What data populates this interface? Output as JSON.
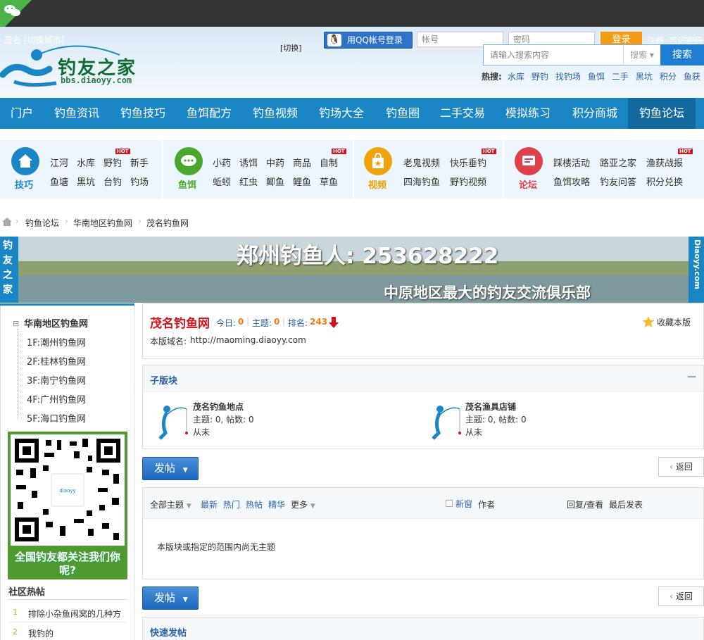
{
  "header": {
    "city": "茂名 [切换城市]",
    "switch": "[切换]",
    "logo_text": "钓友之家",
    "logo_url": "bbs.diaoyy.com",
    "qq_login": "用QQ帐号登录",
    "account_placeholder": "帐号",
    "password_placeholder": "密码",
    "login": "登录",
    "register": "注册",
    "forgot": "忘记密码",
    "search_placeholder": "请输入搜索内容",
    "search_select": "搜索",
    "search_button": "搜索",
    "hot_label": "热搜:",
    "hot_items": [
      "水库",
      "野钓",
      "找钓场",
      "鱼饵",
      "二手",
      "黑坑",
      "积分",
      "鱼获"
    ]
  },
  "nav": {
    "items": [
      "门户",
      "钓鱼资讯",
      "钓鱼技巧",
      "鱼饵配方",
      "钓鱼视频",
      "钓场大全",
      "钓鱼圈",
      "二手交易",
      "模拟练习",
      "积分商城",
      "钓鱼论坛"
    ],
    "active": "钓鱼论坛"
  },
  "quick": {
    "hot_badge": "HOT",
    "sections": [
      {
        "label": "技巧",
        "color": "#1b86c5",
        "icon": "house-icon",
        "row1": [
          "江河",
          "水库",
          "野钓",
          "新手"
        ],
        "row2": [
          "鱼塘",
          "黑坑",
          "台钓",
          "钓场"
        ]
      },
      {
        "label": "鱼饵",
        "color": "#4aa92c",
        "icon": "chat-bubble-icon",
        "row1": [
          "小药",
          "诱饵",
          "中药",
          "商品",
          "自制"
        ],
        "row2": [
          "蚯蚓",
          "红虫",
          "鲫鱼",
          "鲤鱼",
          "草鱼"
        ]
      },
      {
        "label": "视频",
        "color": "#f0a20b",
        "icon": "shopping-bag-icon",
        "row1": [
          "老鬼视频",
          "快乐垂钓"
        ],
        "row2": [
          "四海钓鱼",
          "野钓视频"
        ]
      },
      {
        "label": "论坛",
        "color": "#e0404a",
        "icon": "forum-icon",
        "row1": [
          "踩楼活动",
          "路亚之家",
          "渔获战报"
        ],
        "row2": [
          "鱼饵攻略",
          "钓友问答",
          "积分兑换"
        ]
      }
    ]
  },
  "breadcrumb": [
    "钓鱼论坛",
    "华南地区钓鱼网",
    "茂名钓鱼网"
  ],
  "banner": {
    "left_text": "钓友之家",
    "headline": "郑州钓鱼人: 253628222",
    "sub": "中原地区最大的钓友交流俱乐部",
    "right_text": "Diaoyy.com"
  },
  "sidebar": {
    "tree_root": "华南地区钓鱼网",
    "tree_items": [
      "1F:潮州钓鱼网",
      "2F:桂林钓鱼网",
      "3F:南宁钓鱼网",
      "4F:广州钓鱼网",
      "5F:海口钓鱼网"
    ],
    "qr_caption": "全国钓友都关注我们你呢?",
    "hot_title": "社区热帖",
    "hot_posts": [
      {
        "num": "1",
        "title": "排除小杂鱼闹窝的几种方"
      },
      {
        "num": "2",
        "title": "我钓的"
      }
    ]
  },
  "forum": {
    "name": "茂名钓鱼网",
    "today_label": "今日:",
    "today": "0",
    "topics_label": "主题:",
    "topics": "0",
    "rank_label": "排名:",
    "rank": "243",
    "domain_label": "本版域名:",
    "domain": "http://maoming.diaoyy.com",
    "favorite": "收藏本版"
  },
  "subforums": {
    "title": "子版块",
    "collapse": "—",
    "items": [
      {
        "name": "茂名钓鱼地点",
        "stats": "主题: 0, 帖数: 0",
        "last": "从未"
      },
      {
        "name": "茂名渔具店铺",
        "stats": "主题: 0, 帖数: 0",
        "last": "从未"
      }
    ]
  },
  "actions": {
    "post": "发帖",
    "back": "返回"
  },
  "threads": {
    "filters": [
      "全部主题",
      "最新",
      "热门",
      "热帖",
      "精华",
      "更多"
    ],
    "new_window": "新窗",
    "author": "作者",
    "reply_view": "回复/查看",
    "last_post": "最后发表",
    "empty": "本版块或指定的范围内尚无主题"
  },
  "quick_post": {
    "title": "快速发帖"
  }
}
